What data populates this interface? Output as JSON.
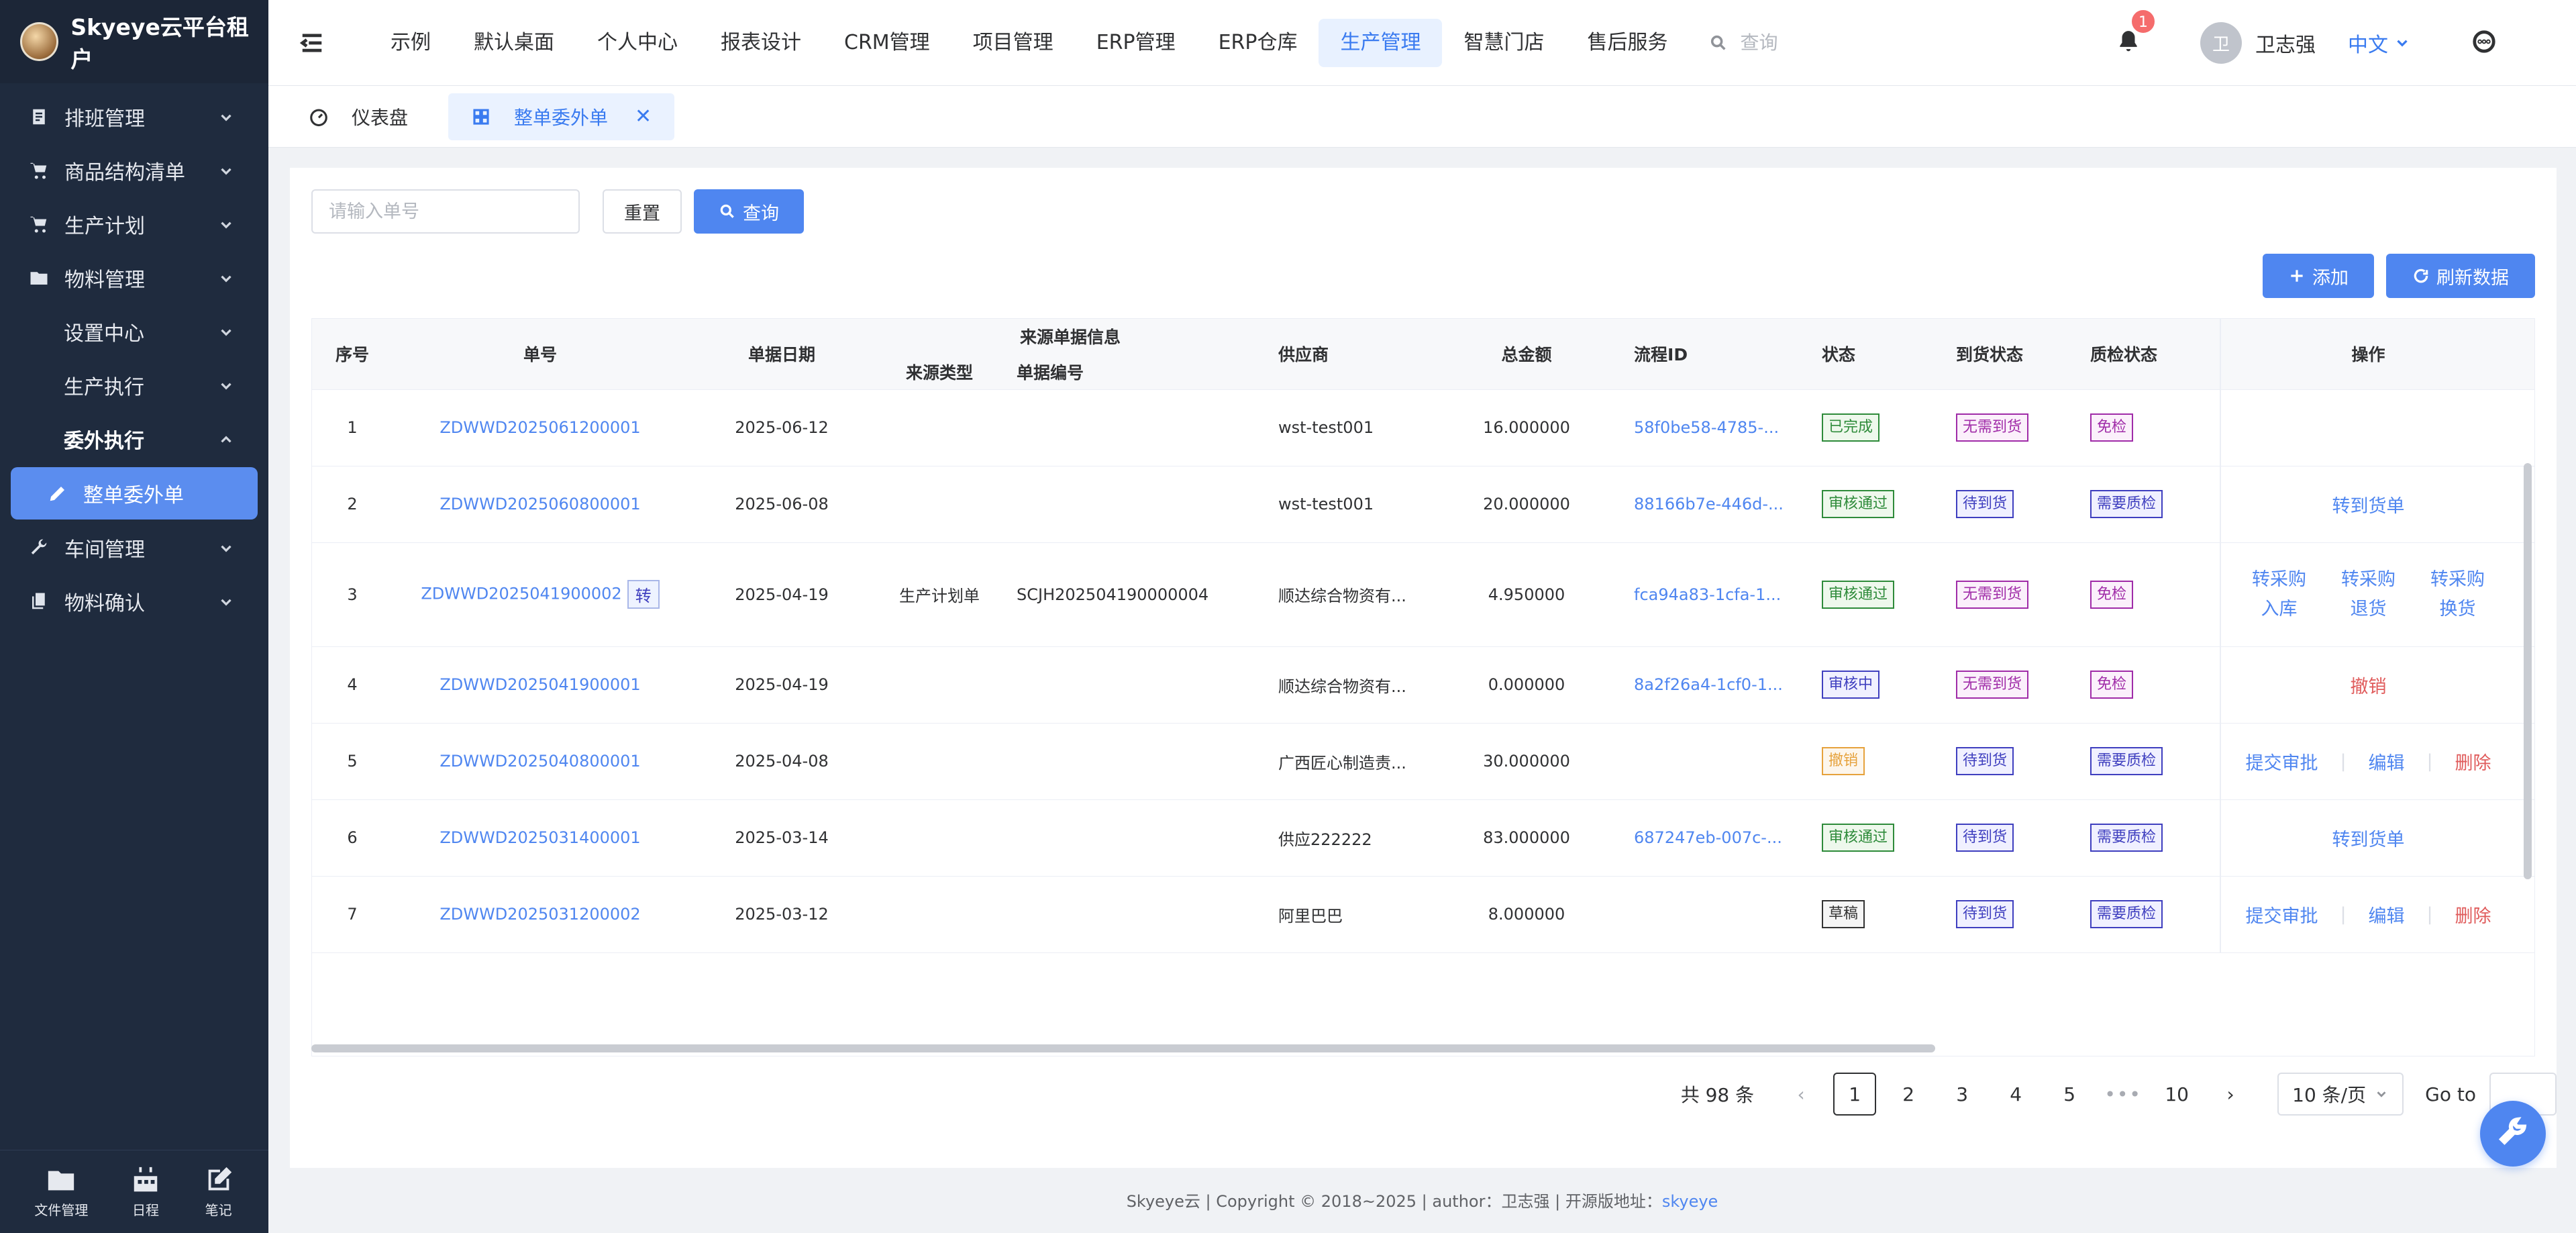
{
  "brand": {
    "title": "Skyeye云平台租户"
  },
  "sidebar": {
    "items": [
      {
        "label": "排班管理",
        "icon": "schedule-icon"
      },
      {
        "label": "商品结构清单",
        "icon": "cart-icon"
      },
      {
        "label": "生产计划",
        "icon": "cart-icon"
      },
      {
        "label": "物料管理",
        "icon": "folder-icon"
      },
      {
        "label": "设置中心",
        "icon": ""
      },
      {
        "label": "生产执行",
        "icon": ""
      },
      {
        "label": "委外执行",
        "icon": ""
      },
      {
        "label": "整单委外单",
        "icon": "pencil-icon"
      },
      {
        "label": "车间管理",
        "icon": "wrench-icon"
      },
      {
        "label": "物料确认",
        "icon": "copy-icon"
      }
    ],
    "bottom": [
      {
        "label": "文件管理",
        "icon": "folder-icon"
      },
      {
        "label": "日程",
        "icon": "calendar-icon"
      },
      {
        "label": "笔记",
        "icon": "edit-icon"
      }
    ]
  },
  "header": {
    "nav": [
      "示例",
      "默认桌面",
      "个人中心",
      "报表设计",
      "CRM管理",
      "项目管理",
      "ERP管理",
      "ERP仓库",
      "生产管理",
      "智慧门店",
      "售后服务"
    ],
    "active_nav": "生产管理",
    "search_placeholder": "查询",
    "notif_count": "1",
    "user_avatar": "卫",
    "user_name": "卫志强",
    "lang": "中文"
  },
  "tags": [
    {
      "label": "仪表盘"
    },
    {
      "label": "整单委外单",
      "close": "✕"
    }
  ],
  "filter": {
    "placeholder": "请输入单号",
    "reset": "重置",
    "search": "查询"
  },
  "toolbar": {
    "add": "添加",
    "refresh": "刷新数据"
  },
  "table": {
    "headers": {
      "index": "序号",
      "order_no": "单号",
      "date": "单据日期",
      "source_group": "来源单据信息",
      "source_type": "来源类型",
      "source_no": "单据编号",
      "supplier": "供应商",
      "amount": "总金额",
      "flow_id": "流程ID",
      "state": "状态",
      "arrival": "到货状态",
      "qc": "质检状态",
      "ops": "操作"
    },
    "rows": [
      {
        "idx": "1",
        "no": "ZDWWD2025061200001",
        "tag": "",
        "date": "2025-06-12",
        "stype": "",
        "sno": "",
        "supplier": "wst-test001",
        "amount": "16.000000",
        "flow": "58f0be58-4785-...",
        "state": "已完成",
        "arrival": "无需到货",
        "qc": "免检",
        "ops": []
      },
      {
        "idx": "2",
        "no": "ZDWWD2025060800001",
        "tag": "",
        "date": "2025-06-08",
        "stype": "",
        "sno": "",
        "supplier": "wst-test001",
        "amount": "20.000000",
        "flow": "88166b7e-446d-...",
        "state": "审核通过",
        "arrival": "待到货",
        "qc": "需要质检",
        "ops": [
          "转到货单"
        ]
      },
      {
        "idx": "3",
        "no": "ZDWWD2025041900002",
        "tag": "转",
        "date": "2025-04-19",
        "stype": "生产计划单",
        "sno": "SCJH202504190000004",
        "supplier": "顺达综合物资有...",
        "amount": "4.950000",
        "flow": "fca94a83-1cfa-1...",
        "state": "审核通过",
        "arrival": "无需到货",
        "qc": "免检",
        "ops": [
          "转采购入库",
          "转采购退货",
          "转采购换货"
        ]
      },
      {
        "idx": "4",
        "no": "ZDWWD2025041900001",
        "tag": "",
        "date": "2025-04-19",
        "stype": "",
        "sno": "",
        "supplier": "顺达综合物资有...",
        "amount": "0.000000",
        "flow": "8a2f26a4-1cf0-1...",
        "state": "审核中",
        "arrival": "无需到货",
        "qc": "免检",
        "ops": [
          "撤销"
        ]
      },
      {
        "idx": "5",
        "no": "ZDWWD2025040800001",
        "tag": "",
        "date": "2025-04-08",
        "stype": "",
        "sno": "",
        "supplier": "广西匠心制造责...",
        "amount": "30.000000",
        "flow": "",
        "state": "撤销",
        "arrival": "待到货",
        "qc": "需要质检",
        "ops": [
          "提交审批",
          "编辑",
          "删除"
        ]
      },
      {
        "idx": "6",
        "no": "ZDWWD2025031400001",
        "tag": "",
        "date": "2025-03-14",
        "stype": "",
        "sno": "",
        "supplier": "供应222222",
        "amount": "83.000000",
        "flow": "687247eb-007c-...",
        "state": "审核通过",
        "arrival": "待到货",
        "qc": "需要质检",
        "ops": [
          "转到货单"
        ]
      },
      {
        "idx": "7",
        "no": "ZDWWD2025031200002",
        "tag": "",
        "date": "2025-03-12",
        "stype": "",
        "sno": "",
        "supplier": "阿里巴巴",
        "amount": "8.000000",
        "flow": "",
        "state": "草稿",
        "arrival": "待到货",
        "qc": "需要质检",
        "ops": [
          "提交审批",
          "编辑",
          "删除"
        ]
      }
    ]
  },
  "pager": {
    "total": "共 98 条",
    "pages": [
      "1",
      "2",
      "3",
      "4",
      "5"
    ],
    "dots": "•••",
    "last": "10",
    "size": "10 条/页",
    "goto": "Go to"
  },
  "footer": {
    "text": "Skyeye云 | Copyright © 2018~2025 | author：卫志强 | 开源版地址：",
    "link": "skyeye"
  },
  "colors": {
    "accent": "#4f86f0",
    "sidebar_bg": "#1f2b3e",
    "danger": "#e05c5c"
  }
}
